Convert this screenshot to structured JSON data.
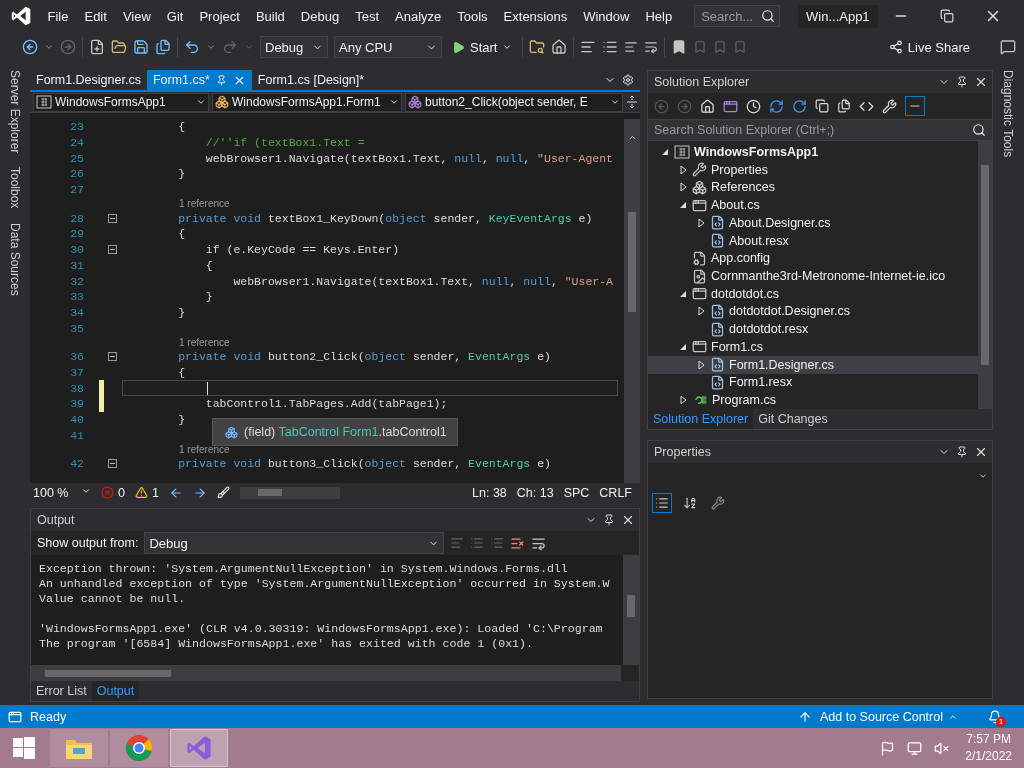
{
  "menu": {
    "items": [
      "File",
      "Edit",
      "View",
      "Git",
      "Project",
      "Build",
      "Debug",
      "Test",
      "Analyze",
      "Tools",
      "Extensions",
      "Window",
      "Help"
    ],
    "search": {
      "placeholder": "Search..."
    },
    "title": "Win...App1"
  },
  "toolbar": {
    "configuration": "Debug",
    "platform": "Any CPU",
    "start": "Start",
    "live_share": "Live Share"
  },
  "left_strip": [
    "Server Explorer",
    "Toolbox",
    "Data Sources"
  ],
  "editor": {
    "tabs": [
      {
        "label": "Form1.Designer.cs",
        "selected": false
      },
      {
        "label": "Form1.cs*",
        "selected": true
      },
      {
        "label": "Form1.cs [Design]*",
        "selected": false
      }
    ],
    "nav": [
      {
        "kind": "project",
        "label": "WindowsFormsApp1"
      },
      {
        "kind": "class",
        "label": "WindowsFormsApp1.Form1"
      },
      {
        "kind": "method",
        "label": "button2_Click(object sender, E"
      }
    ],
    "lines": [
      {
        "kind": "code",
        "number": "23",
        "fold": false,
        "modified": false,
        "current": false,
        "segments": [
          {
            "kind": "plain",
            "text": "        {"
          }
        ]
      },
      {
        "kind": "code",
        "number": "24",
        "fold": false,
        "modified": false,
        "current": false,
        "segments": [
          {
            "kind": "comment",
            "text": "            //''if (textBox1.Text ="
          }
        ]
      },
      {
        "kind": "code",
        "number": "25",
        "fold": false,
        "modified": false,
        "current": false,
        "segments": [
          {
            "kind": "plain",
            "text": "            webBrowser1.Navigate(textBox1.Text, "
          },
          {
            "kind": "keyword",
            "text": "null"
          },
          {
            "kind": "plain",
            "text": ", "
          },
          {
            "kind": "keyword",
            "text": "null"
          },
          {
            "kind": "plain",
            "text": ", "
          },
          {
            "kind": "string",
            "text": "\"User-Agent"
          }
        ]
      },
      {
        "kind": "code",
        "number": "26",
        "fold": false,
        "modified": false,
        "current": false,
        "segments": [
          {
            "kind": "plain",
            "text": "        }"
          }
        ]
      },
      {
        "kind": "code",
        "number": "27",
        "fold": false,
        "modified": false,
        "current": false
      },
      {
        "kind": "lens",
        "text": "1 reference"
      },
      {
        "kind": "code",
        "number": "28",
        "fold": true,
        "modified": false,
        "current": false,
        "segments": [
          {
            "kind": "keyword",
            "text": "        private void"
          },
          {
            "kind": "plain",
            "text": " textBox1_KeyDown("
          },
          {
            "kind": "keyword",
            "text": "object"
          },
          {
            "kind": "plain",
            "text": " sender, "
          },
          {
            "kind": "type",
            "text": "KeyEventArgs"
          },
          {
            "kind": "plain",
            "text": " e)"
          }
        ]
      },
      {
        "kind": "code",
        "number": "29",
        "fold": false,
        "modified": false,
        "current": false,
        "segments": [
          {
            "kind": "plain",
            "text": "        {"
          }
        ]
      },
      {
        "kind": "code",
        "number": "30",
        "fold": true,
        "modified": false,
        "current": false,
        "segments": [
          {
            "kind": "plain",
            "text": "            if (e.KeyCode == Keys.Enter)"
          }
        ]
      },
      {
        "kind": "code",
        "number": "31",
        "fold": false,
        "modified": false,
        "current": false,
        "segments": [
          {
            "kind": "plain",
            "text": "            {"
          }
        ]
      },
      {
        "kind": "code",
        "number": "32",
        "fold": false,
        "modified": false,
        "current": false,
        "segments": [
          {
            "kind": "plain",
            "text": "                webBrowser1.Navigate(textBox1.Text, "
          },
          {
            "kind": "keyword",
            "text": "null"
          },
          {
            "kind": "plain",
            "text": ", "
          },
          {
            "kind": "keyword",
            "text": "null"
          },
          {
            "kind": "plain",
            "text": ", "
          },
          {
            "kind": "string",
            "text": "\"User-A"
          }
        ]
      },
      {
        "kind": "code",
        "number": "33",
        "fold": false,
        "modified": false,
        "current": false,
        "segments": [
          {
            "kind": "plain",
            "text": "            }"
          }
        ]
      },
      {
        "kind": "code",
        "number": "34",
        "fold": false,
        "modified": false,
        "current": false,
        "segments": [
          {
            "kind": "plain",
            "text": "        }"
          }
        ]
      },
      {
        "kind": "code",
        "number": "35",
        "fold": false,
        "modified": false,
        "current": false
      },
      {
        "kind": "lens",
        "text": "1 reference"
      },
      {
        "kind": "code",
        "number": "36",
        "fold": true,
        "modified": false,
        "current": false,
        "segments": [
          {
            "kind": "keyword",
            "text": "        private void"
          },
          {
            "kind": "plain",
            "text": " button2_Click("
          },
          {
            "kind": "keyword",
            "text": "object"
          },
          {
            "kind": "plain",
            "text": " sender, "
          },
          {
            "kind": "type",
            "text": "EventArgs"
          },
          {
            "kind": "plain",
            "text": " e)"
          }
        ]
      },
      {
        "kind": "code",
        "number": "37",
        "fold": false,
        "modified": false,
        "current": false,
        "segments": [
          {
            "kind": "plain",
            "text": "        {"
          }
        ]
      },
      {
        "kind": "code",
        "number": "38",
        "fold": false,
        "modified": true,
        "current": true
      },
      {
        "kind": "code",
        "number": "39",
        "fold": false,
        "modified": true,
        "current": false,
        "segments": [
          {
            "kind": "plain",
            "text": "            tabControl1.TabPages.Add(tabPage1);"
          }
        ]
      },
      {
        "kind": "code",
        "number": "40",
        "fold": false,
        "modified": false,
        "current": false,
        "segments": [
          {
            "kind": "plain",
            "text": "        }"
          }
        ]
      },
      {
        "kind": "code",
        "number": "41",
        "fold": false,
        "modified": false,
        "current": false
      },
      {
        "kind": "lens",
        "text": "1 reference"
      },
      {
        "kind": "code",
        "number": "42",
        "fold": true,
        "modified": false,
        "current": false,
        "segments": [
          {
            "kind": "keyword",
            "text": "        private void"
          },
          {
            "kind": "plain",
            "text": " button3_Click("
          },
          {
            "kind": "keyword",
            "text": "object"
          },
          {
            "kind": "plain",
            "text": " sender, "
          },
          {
            "kind": "type",
            "text": "EventArgs"
          },
          {
            "kind": "plain",
            "text": " e)"
          }
        ]
      }
    ],
    "tooltip": [
      {
        "kind": "plain",
        "text": "(field) "
      },
      {
        "kind": "type",
        "text": "TabControl Form1"
      },
      {
        "kind": "plain",
        "text": ".tabControl1"
      }
    ],
    "status": {
      "zoom": "100 %",
      "errors": "0",
      "warnings": "1",
      "line": "Ln: 38",
      "column": "Ch: 13",
      "indent": "SPC",
      "line_ending": "CRLF"
    }
  },
  "output": {
    "title": "Output",
    "source_label": "Show output from:",
    "source": "Debug",
    "groups": [
      [
        "Exception thrown: 'System.ArgumentNullException' in System.Windows.Forms.dll",
        "An unhandled exception of type 'System.ArgumentNullException' occurred in System.W",
        "Value cannot be null."
      ],
      [
        "'WindowsFormsApp1.exe' (CLR v4.0.30319: WindowsFormsApp1.exe): Loaded 'C:\\Program",
        "The program '[6584] WindowsFormsApp1.exe' has exited with code 1 (0x1)."
      ]
    ],
    "tabs": [
      {
        "label": "Error List",
        "selected": false
      },
      {
        "label": "Output",
        "selected": true
      }
    ]
  },
  "solution_explorer": {
    "title": "Solution Explorer",
    "search": {
      "placeholder": "Search Solution Explorer (Ctrl+;)"
    },
    "tree": [
      {
        "label": "WindowsFormsApp1",
        "kind": "project",
        "expanded": true,
        "selected": false,
        "children": [
          {
            "label": "Properties",
            "kind": "wrench",
            "expanded": false,
            "selected": false
          },
          {
            "label": "References",
            "kind": "references",
            "expanded": false,
            "selected": false
          },
          {
            "label": "About.cs",
            "kind": "form",
            "expanded": true,
            "selected": false,
            "children": [
              {
                "label": "About.Designer.cs",
                "kind": "file",
                "expanded": false,
                "selected": false
              },
              {
                "label": "About.resx",
                "kind": "file",
                "selected": false
              }
            ]
          },
          {
            "label": "App.config",
            "kind": "config",
            "selected": false
          },
          {
            "label": "Cornmanthe3rd-Metronome-Internet-ie.ico",
            "kind": "image",
            "selected": false
          },
          {
            "label": "dotdotdot.cs",
            "kind": "form",
            "expanded": true,
            "selected": false,
            "children": [
              {
                "label": "dotdotdot.Designer.cs",
                "kind": "file",
                "expanded": false,
                "selected": false
              },
              {
                "label": "dotdotdot.resx",
                "kind": "file",
                "selected": false
              }
            ]
          },
          {
            "label": "Form1.cs",
            "kind": "form",
            "expanded": true,
            "selected": false,
            "children": [
              {
                "label": "Form1.Designer.cs",
                "kind": "file",
                "expanded": false,
                "selected": true
              },
              {
                "label": "Form1.resx",
                "kind": "file",
                "selected": false
              }
            ]
          },
          {
            "label": "Program.cs",
            "kind": "csharp",
            "expanded": false,
            "selected": false
          }
        ]
      }
    ],
    "tabs": [
      {
        "label": "Solution Explorer",
        "selected": true
      },
      {
        "label": "Git Changes",
        "selected": false
      }
    ]
  },
  "properties": {
    "title": "Properties"
  },
  "right_strip": [
    "Diagnostic Tools"
  ],
  "status_bar": {
    "text": "Ready",
    "source_control": "Add to Source Control",
    "notifications": "1"
  },
  "taskbar": {
    "apps": [
      {
        "kind": "explorer",
        "selected": false
      },
      {
        "kind": "browser",
        "selected": false
      },
      {
        "kind": "ide",
        "selected": true
      }
    ],
    "time": "7:57 PM",
    "date": "2/1/2022"
  }
}
